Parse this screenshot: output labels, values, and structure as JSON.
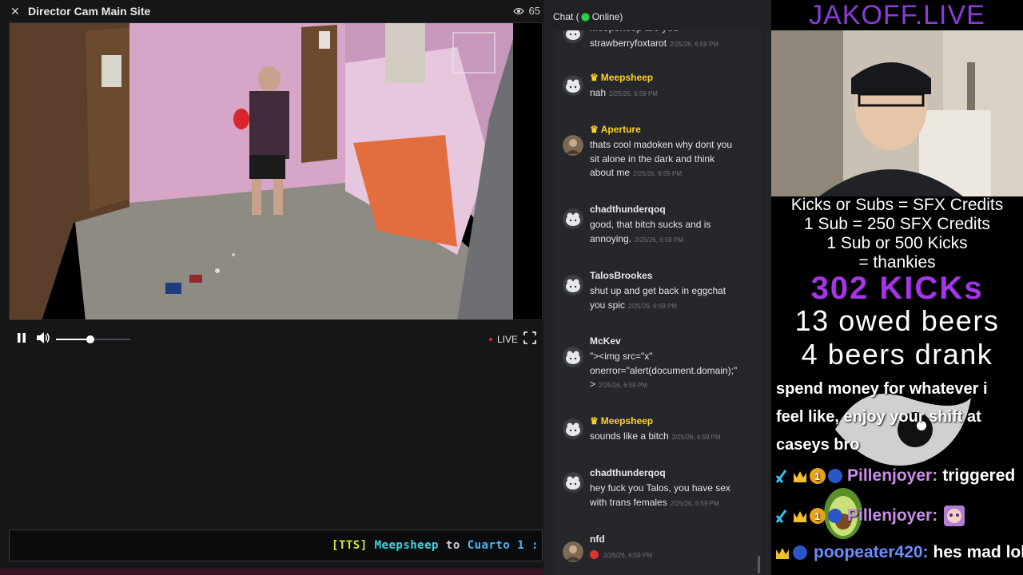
{
  "player": {
    "title": "Director Cam Main Site",
    "close_icon": "close-icon",
    "viewer_count": "65",
    "viewer_icon": "eye-icon",
    "volume_level": 0.46,
    "live_label": "LIVE",
    "playing": true
  },
  "tts": {
    "tag": "[TTS]",
    "user": "Meepsheep",
    "mid": "to",
    "room": "Cuarto 1 :"
  },
  "chat": {
    "title_prefix": "Chat (",
    "title_status": "Online)",
    "messages": [
      {
        "user": "Meepsheep are you",
        "vip": false,
        "lines": [
          "strawberryfoxtarot"
        ],
        "time": "2/25/26, 6:59 PM",
        "partial": true
      },
      {
        "user": "Meepsheep",
        "vip": true,
        "lines": [
          "nah"
        ],
        "time": "2/25/26, 6:59 PM"
      },
      {
        "user": "Aperture",
        "vip": true,
        "lines": [
          "thats cool madoken why dont you",
          "sit alone in the dark and think",
          "about me"
        ],
        "time": "2/25/26, 6:59 PM",
        "photo": true
      },
      {
        "user": "chadthunderqoq",
        "vip": false,
        "lines": [
          "good, that bitch sucks and is",
          "annoying."
        ],
        "time": "2/25/26, 6:59 PM"
      },
      {
        "user": "TalosBrookes",
        "vip": false,
        "lines": [
          "shut up and get back in eggchat",
          "you spic"
        ],
        "time": "2/25/26, 6:59 PM"
      },
      {
        "user": "McKev",
        "vip": false,
        "lines": [
          "\"><img src=\"x\"",
          "onerror=\"alert(document.domain);\"",
          ">"
        ],
        "time": "2/25/26, 6:59 PM"
      },
      {
        "user": "Meepsheep",
        "vip": true,
        "lines": [
          "sounds like a bitch"
        ],
        "time": "2/25/26, 6:59 PM"
      },
      {
        "user": "chadthunderqoq",
        "vip": false,
        "lines": [
          "hey fuck you Talos, you have sex",
          "with trans females"
        ],
        "time": "2/25/26, 6:59 PM"
      },
      {
        "user": "nfd",
        "vip": false,
        "lines": [
          ""
        ],
        "time": "2/25/26, 6:59 PM",
        "emoji": "angry-face-icon",
        "photo": true
      }
    ]
  },
  "stream": {
    "title": "JAKOFF.LIVE",
    "credits": [
      "Kicks or Subs = SFX Credits",
      "1 Sub = 250 SFX Credits",
      "1 Sub or 500 Kicks",
      "= thankies"
    ],
    "kicks": "302 KICKs",
    "owed": "13 owed beers",
    "drank": "4 beers drank",
    "donation": "spend money for whatever i feel like, enjoy your shift at caseys bro",
    "chat_lines": [
      {
        "user": "Pillenjoyer:",
        "msg": "triggered",
        "badges": [
          "verified-icon",
          "crown-icon",
          "gold-1-badge-icon",
          "blue-orb-icon"
        ]
      },
      {
        "user": "Pillenjoyer:",
        "msg": "",
        "badges": [
          "verified-icon",
          "crown-icon",
          "gold-1-badge-icon",
          "blue-orb-icon"
        ],
        "emote": "anime-face-emote-icon"
      },
      {
        "user": "poopeater420:",
        "msg": "hes mad lol",
        "badges": [
          "crown-icon",
          "blue-orb-icon"
        ]
      }
    ]
  }
}
